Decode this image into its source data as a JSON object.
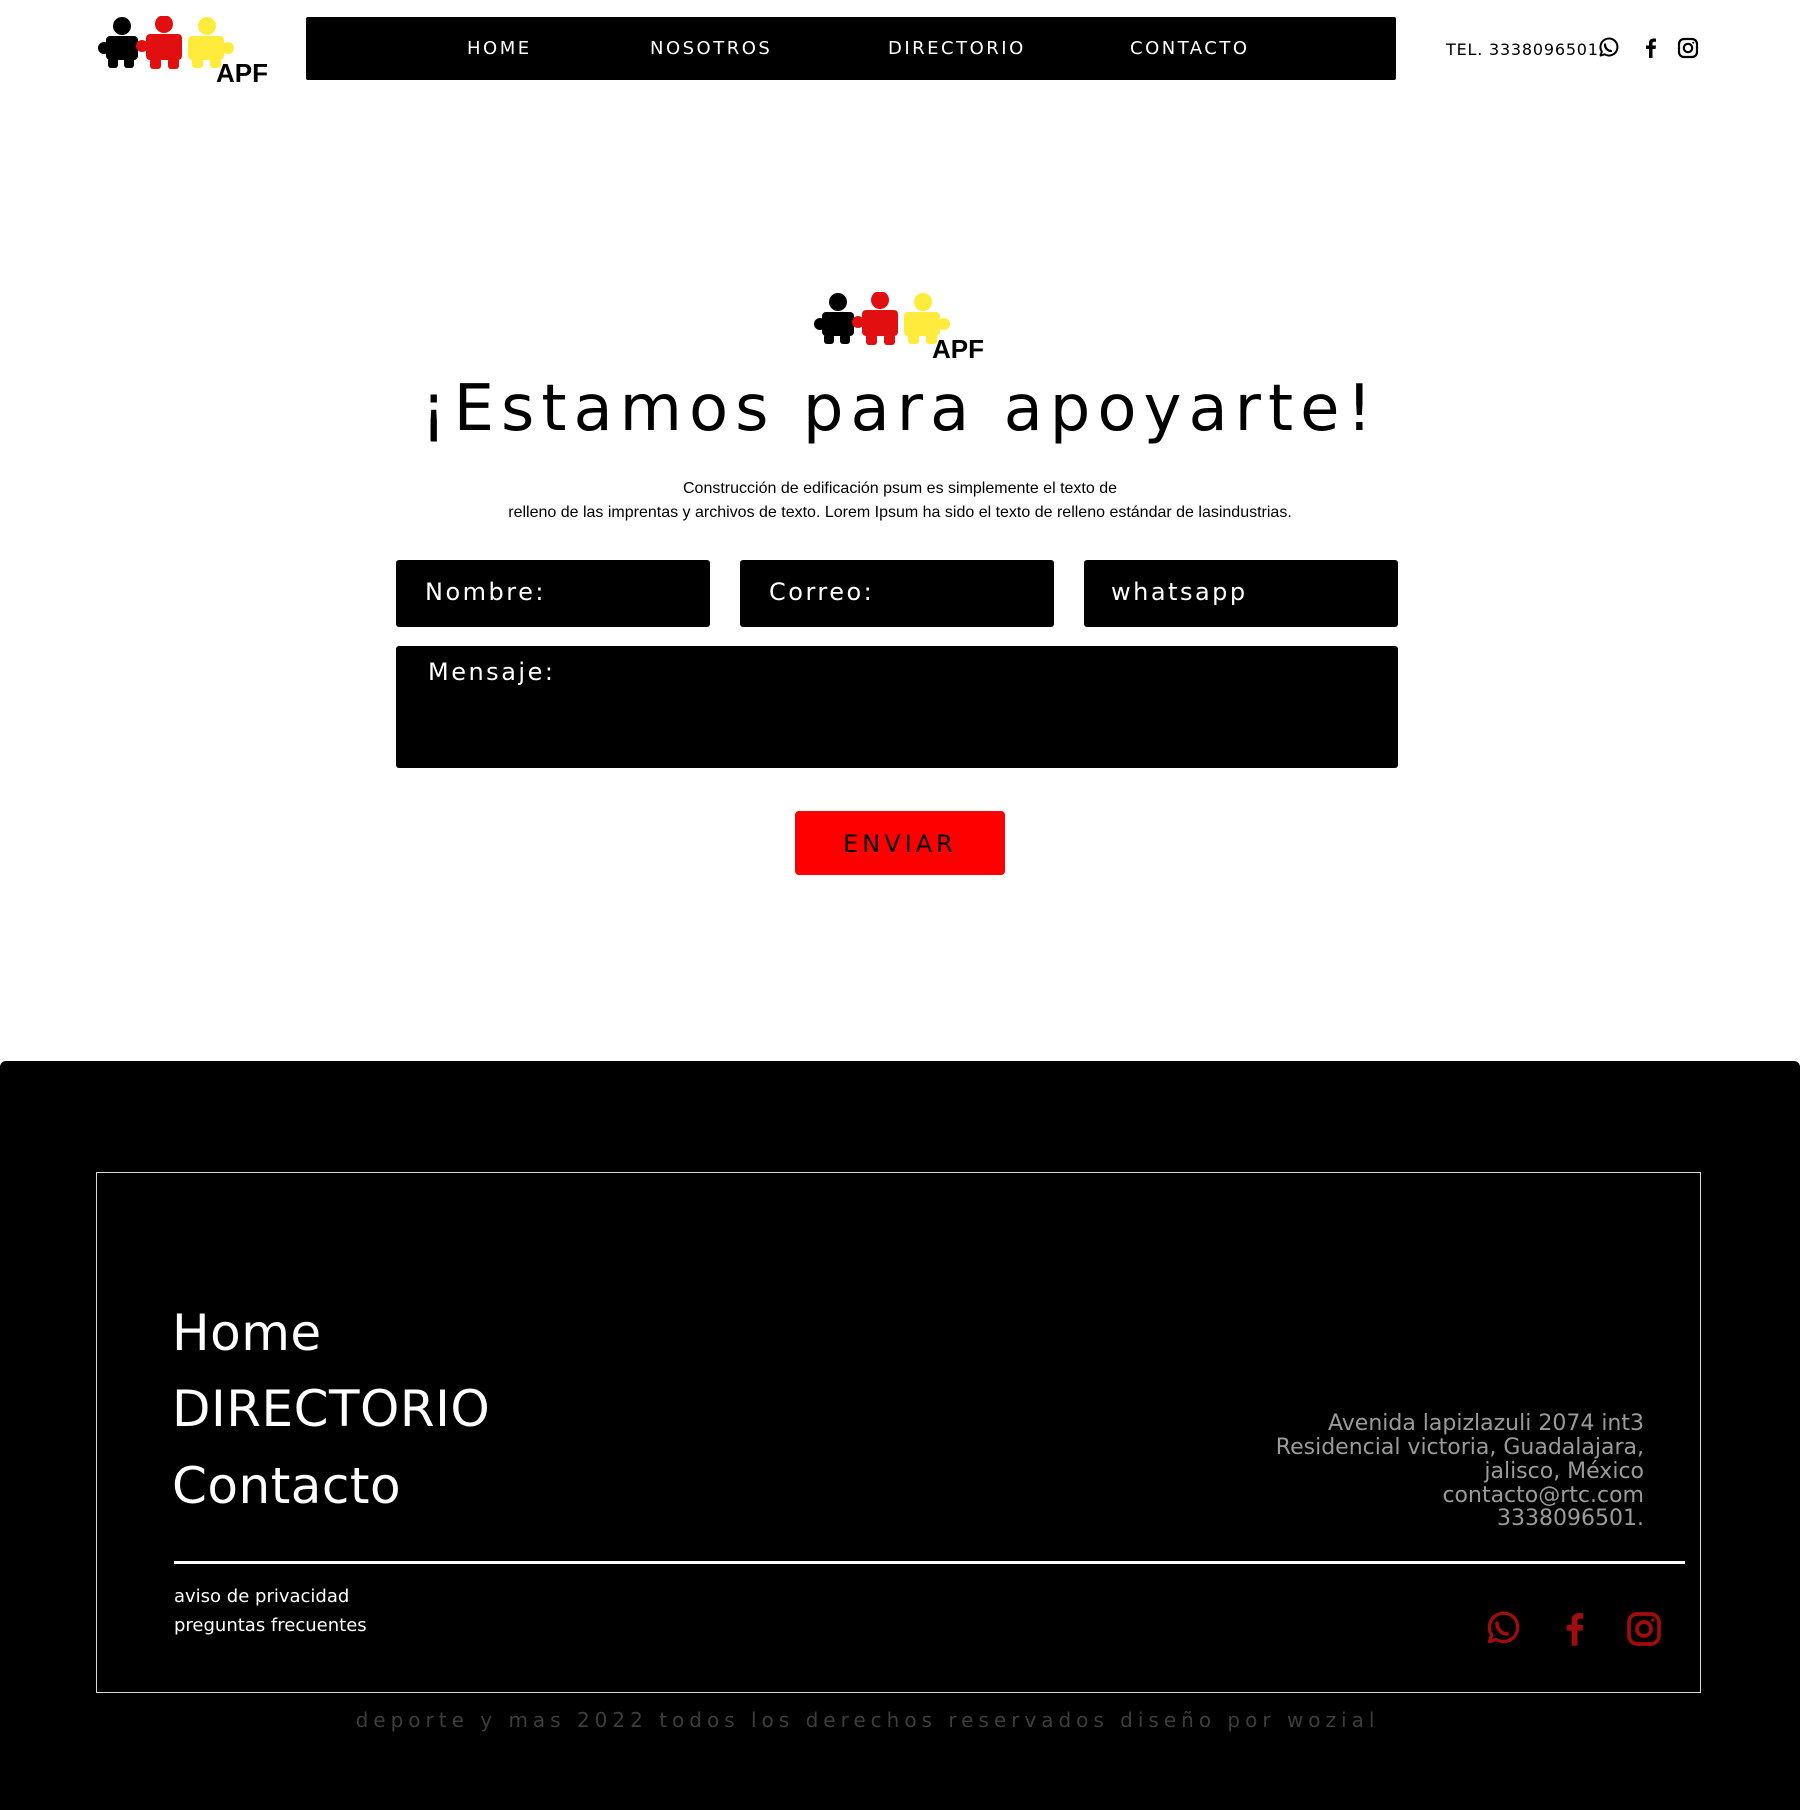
{
  "brand": {
    "logo_text": "APF",
    "colors": {
      "piece_black": "#000000",
      "piece_red": "#e10f0f",
      "piece_yellow": "#ffeb3b"
    }
  },
  "header": {
    "nav": [
      {
        "label": "HOME"
      },
      {
        "label": "NOSOTROS"
      },
      {
        "label": "DIRECTORIO"
      },
      {
        "label": "CONTACTO"
      }
    ],
    "phone": "TEL.  3338096501",
    "social_icons": [
      "whatsapp-icon",
      "facebook-icon",
      "instagram-icon"
    ]
  },
  "contact": {
    "heading": "¡Estamos para apoyarte!",
    "intro_line_1": "Construcción de edificación psum es simplemente el texto de",
    "intro_line_2": "relleno de las imprentas y archivos de texto. Lorem Ipsum ha sido el texto de relleno estándar de lasindustrias.",
    "fields": {
      "nombre_placeholder": "Nombre:",
      "correo_placeholder": "Correo:",
      "whatsapp_placeholder": "whatsapp",
      "mensaje_placeholder": "Mensaje:"
    },
    "submit_label": "ENVIAR",
    "accent_color": "#ff0000"
  },
  "footer": {
    "links": [
      "Home",
      "DIRECTORIO",
      "Contacto"
    ],
    "address_lines": [
      "Avenida lapizlazuli 2074 int3",
      "Residencial victoria, Guadalajara,",
      "jalisco, México",
      "contacto@rtc.com",
      "3338096501."
    ],
    "legal": {
      "privacy": "aviso de privacidad",
      "faq": "preguntas frecuentes"
    },
    "social_icons": [
      "whatsapp-icon",
      "facebook-icon",
      "instagram-icon"
    ],
    "icon_color": "#a10d0d",
    "copyright": "deporte y mas 2022 todos los derechos reservados diseño por wozial"
  }
}
